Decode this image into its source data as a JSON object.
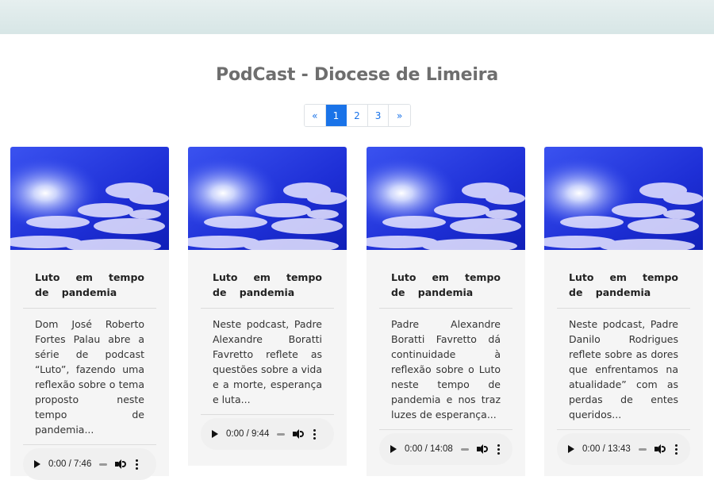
{
  "page": {
    "title": "PodCast - Diocese de Limeira"
  },
  "pagination": {
    "prev": "«",
    "pages": [
      "1",
      "2",
      "3"
    ],
    "active": "1",
    "next": "»"
  },
  "cards": [
    {
      "title": "Luto em tempo de pandemia",
      "description": "Dom José Roberto Fortes Palau abre a série de podcast “Luto”, fazendo uma reflexão sobre o tema proposto neste tempo de pandemia...",
      "audio_time": "0:00 / 7:46"
    },
    {
      "title": "Luto em tempo de pandemia",
      "description": "Neste podcast, Padre Alexandre Boratti Favretto reflete as questões sobre a vida e a morte, esperança e luta...",
      "audio_time": "0:00 / 9:44"
    },
    {
      "title": "Luto em tempo de pandemia",
      "description": "Padre Alexandre Boratti Favretto dá continuidade à reflexão sobre o Luto neste tempo de pandemia e nos traz luzes de esperança...",
      "audio_time": "0:00 / 14:08"
    },
    {
      "title": "Luto em tempo de pandemia",
      "description": "Neste podcast, Padre Danilo Rodrigues reflete sobre as dores que enfrentamos na atualidade” com as perdas de entes queridos...",
      "audio_time": "0:00 / 13:43"
    }
  ],
  "colors": {
    "accent": "#1a73e8",
    "title": "#6e6e6e",
    "card_bg": "#f5f5f5",
    "sky": "#1e2fd6"
  },
  "icons": {
    "play": "play-icon",
    "volume": "volume-icon",
    "more": "more-options-icon",
    "image": "sky-sun-image"
  }
}
